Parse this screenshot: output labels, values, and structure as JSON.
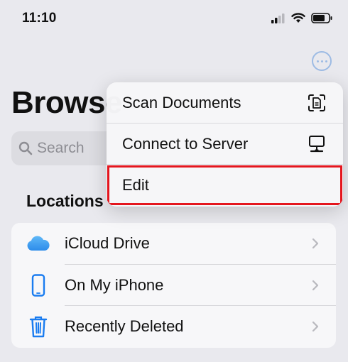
{
  "status_bar": {
    "time": "11:10"
  },
  "header": {
    "title": "Browse",
    "more_icon": "ellipsis-circle-icon"
  },
  "search": {
    "placeholder": "Search",
    "icon": "magnifier-icon"
  },
  "locations": {
    "title": "Locations",
    "items": [
      {
        "label": "iCloud Drive",
        "icon": "icloud-icon"
      },
      {
        "label": "On My iPhone",
        "icon": "iphone-icon"
      },
      {
        "label": "Recently Deleted",
        "icon": "trash-icon"
      }
    ]
  },
  "menu": {
    "items": [
      {
        "label": "Scan Documents",
        "icon": "scan-document-icon"
      },
      {
        "label": "Connect to Server",
        "icon": "server-display-icon"
      },
      {
        "label": "Edit",
        "icon": ""
      }
    ],
    "highlight_color": "#e4161e"
  },
  "colors": {
    "accent": "#1a7cf0",
    "highlight": "#e4161e"
  }
}
